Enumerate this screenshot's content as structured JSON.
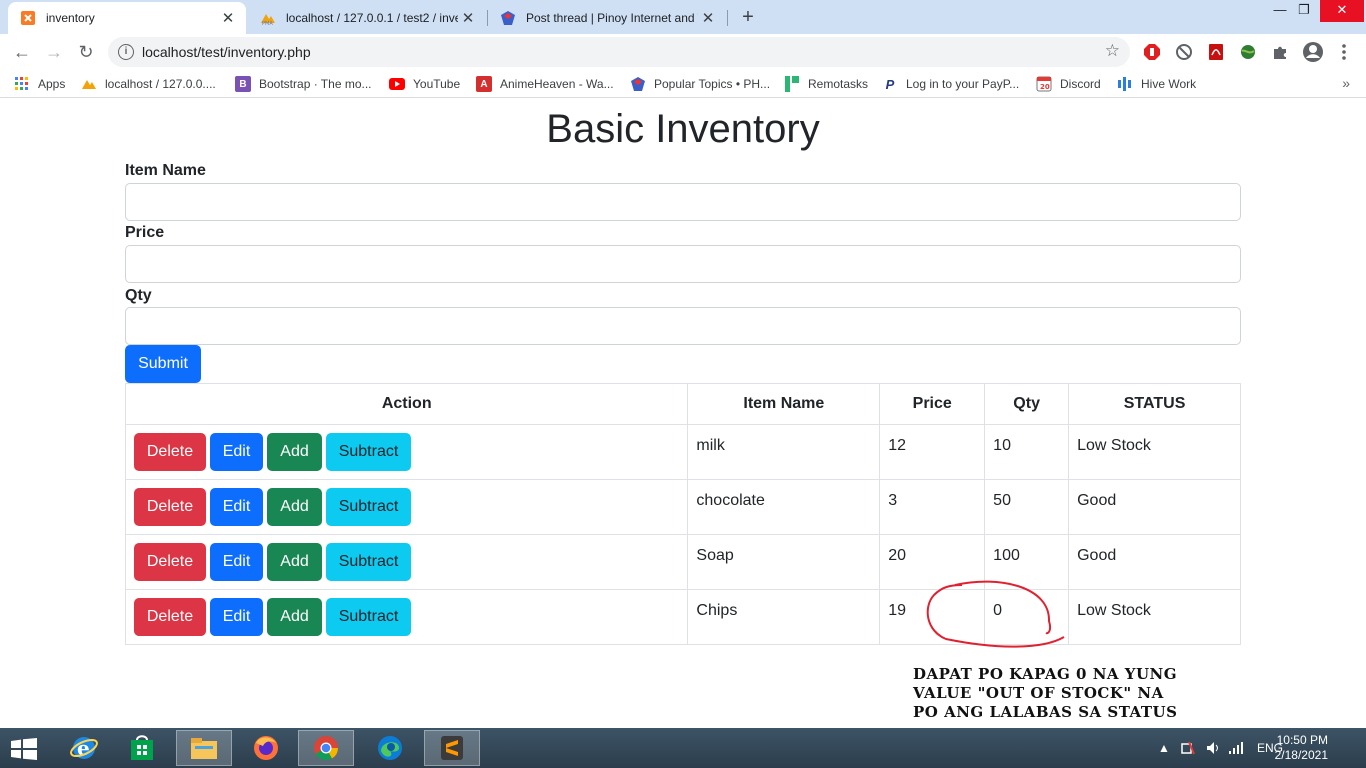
{
  "browser": {
    "tabs": [
      {
        "title": "inventory",
        "favicon": "xampp-icon"
      },
      {
        "title": "localhost / 127.0.0.1 / test2 / inve",
        "favicon": "phpmyadmin-icon"
      },
      {
        "title": "Post thread | Pinoy Internet and T",
        "favicon": "forum-icon"
      }
    ],
    "new_tab_label": "+",
    "url": "localhost/test/inventory.php",
    "bookmarks": [
      {
        "label": "Apps",
        "icon": "apps-grid-icon"
      },
      {
        "label": "localhost / 127.0.0....",
        "icon": "phpmyadmin-icon"
      },
      {
        "label": "Bootstrap · The mo...",
        "icon": "bootstrap-icon"
      },
      {
        "label": "YouTube",
        "icon": "youtube-icon"
      },
      {
        "label": "AnimeHeaven - Wa...",
        "icon": "animeheaven-icon"
      },
      {
        "label": "Popular Topics • PH...",
        "icon": "forum-icon"
      },
      {
        "label": "Remotasks",
        "icon": "remotasks-icon"
      },
      {
        "label": "Log in to your PayP...",
        "icon": "paypal-icon"
      },
      {
        "label": "Discord",
        "icon": "discord-icon"
      },
      {
        "label": "Hive Work",
        "icon": "hive-icon"
      }
    ],
    "bookmarks_overflow": "»"
  },
  "page": {
    "title": "Basic Inventory",
    "form": {
      "item_name_label": "Item Name",
      "item_name_value": "",
      "price_label": "Price",
      "price_value": "",
      "qty_label": "Qty",
      "qty_value": "",
      "submit_label": "Submit"
    },
    "table": {
      "headers": [
        "Action",
        "Item Name",
        "Price",
        "Qty",
        "STATUS"
      ],
      "action_labels": {
        "delete": "Delete",
        "edit": "Edit",
        "add": "Add",
        "subtract": "Subtract"
      },
      "rows": [
        {
          "name": "milk",
          "price": "12",
          "qty": "10",
          "status": "Low Stock"
        },
        {
          "name": "chocolate",
          "price": "3",
          "qty": "50",
          "status": "Good"
        },
        {
          "name": "Soap",
          "price": "20",
          "qty": "100",
          "status": "Good"
        },
        {
          "name": "Chips",
          "price": "19",
          "qty": "0",
          "status": "Low Stock"
        }
      ]
    },
    "annotation": {
      "line1": "Dapat po kapag 0 na yung",
      "line2": "value \"out of stock\" na",
      "line3": "po ang lalabas sa status",
      "color": "#e0212f"
    }
  },
  "taskbar": {
    "apps": [
      "internet-explorer-icon",
      "store-icon",
      "file-explorer-icon",
      "firefox-icon",
      "chrome-icon",
      "edge-icon",
      "sublime-text-icon"
    ],
    "active_app": "chrome-icon",
    "language": "ENG",
    "time": "10:50 PM",
    "date": "2/18/2021"
  },
  "colors": {
    "primary": "#0d6efd",
    "danger": "#dc3545",
    "success": "#198754",
    "info": "#0dcaf0",
    "tabstrip": "#cfe0f5"
  }
}
